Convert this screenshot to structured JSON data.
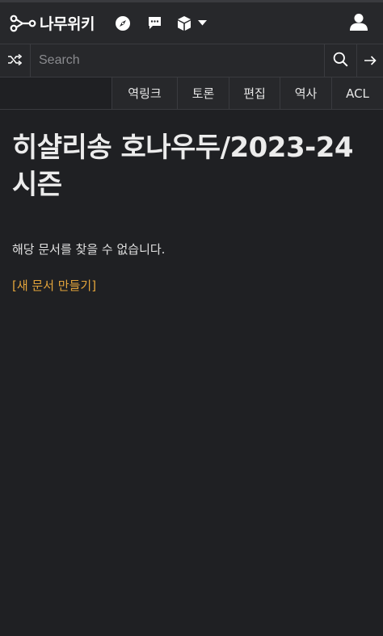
{
  "header": {
    "logo_text": "나무위키",
    "icons": {
      "logo": "namu-tree-icon",
      "recent": "compass-icon",
      "discuss": "chat-bubble-icon",
      "special": "box-icon",
      "dropdown": "caret-down-icon",
      "user": "user-icon"
    }
  },
  "search": {
    "placeholder": "Search",
    "value": "",
    "icons": {
      "random": "shuffle-icon",
      "search": "search-icon",
      "go": "arrow-right-icon"
    }
  },
  "tabs": [
    {
      "label": "역링크"
    },
    {
      "label": "토론"
    },
    {
      "label": "편집"
    },
    {
      "label": "역사"
    },
    {
      "label": "ACL"
    }
  ],
  "page": {
    "title": "히샬리송 호나우두/2023-24 시즌",
    "notice": "해당 문서를 찾을 수 없습니다.",
    "create_link": "[새 문서 만들기]"
  },
  "colors": {
    "background": "#1f2023",
    "bar": "#27282b",
    "link": "#e3a43b"
  }
}
